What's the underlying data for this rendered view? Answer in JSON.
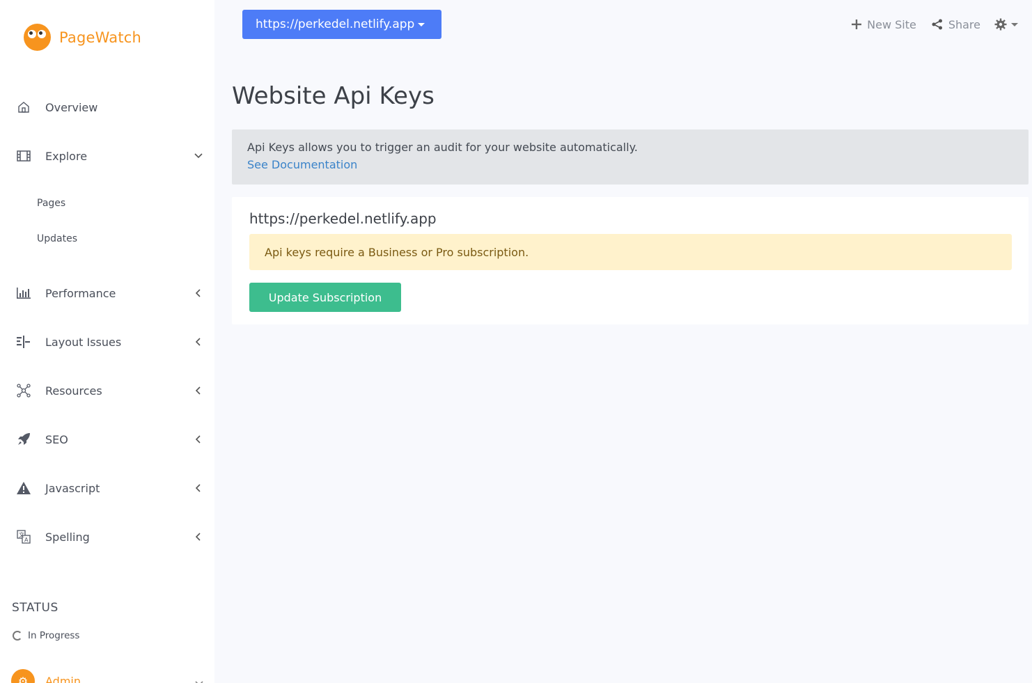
{
  "brand": {
    "name": "PageWatch",
    "color": "#f7941e"
  },
  "sidebar": {
    "items": [
      {
        "label": "Overview",
        "icon": "home-icon"
      },
      {
        "label": "Explore",
        "icon": "film-icon",
        "expanded": true
      },
      {
        "label": "Performance",
        "icon": "bar-chart-icon"
      },
      {
        "label": "Layout Issues",
        "icon": "layout-icon"
      },
      {
        "label": "Resources",
        "icon": "network-icon"
      },
      {
        "label": "SEO",
        "icon": "rocket-icon"
      },
      {
        "label": "Javascript",
        "icon": "warning-icon"
      },
      {
        "label": "Spelling",
        "icon": "translate-icon"
      }
    ],
    "sub_items": [
      {
        "label": "Pages"
      },
      {
        "label": "Updates"
      }
    ],
    "status": {
      "title": "STATUS",
      "value": "In Progress"
    },
    "admin": {
      "label": "Admin"
    }
  },
  "header": {
    "site_selector": "https://perkedel.netlify.app",
    "new_site": "New Site",
    "share": "Share"
  },
  "main": {
    "title": "Website Api Keys",
    "info": {
      "text": "Api Keys allows you to trigger an audit for your website automatically.",
      "link": "See Documentation"
    },
    "card": {
      "site": "https://perkedel.netlify.app",
      "warning": "Api keys require a Business or Pro subscription.",
      "button": "Update Subscription"
    }
  },
  "colors": {
    "primary": "#4d7cf7",
    "success": "#3dbd8e",
    "warning_bg": "#fff2cc",
    "link": "#3a83c9"
  }
}
